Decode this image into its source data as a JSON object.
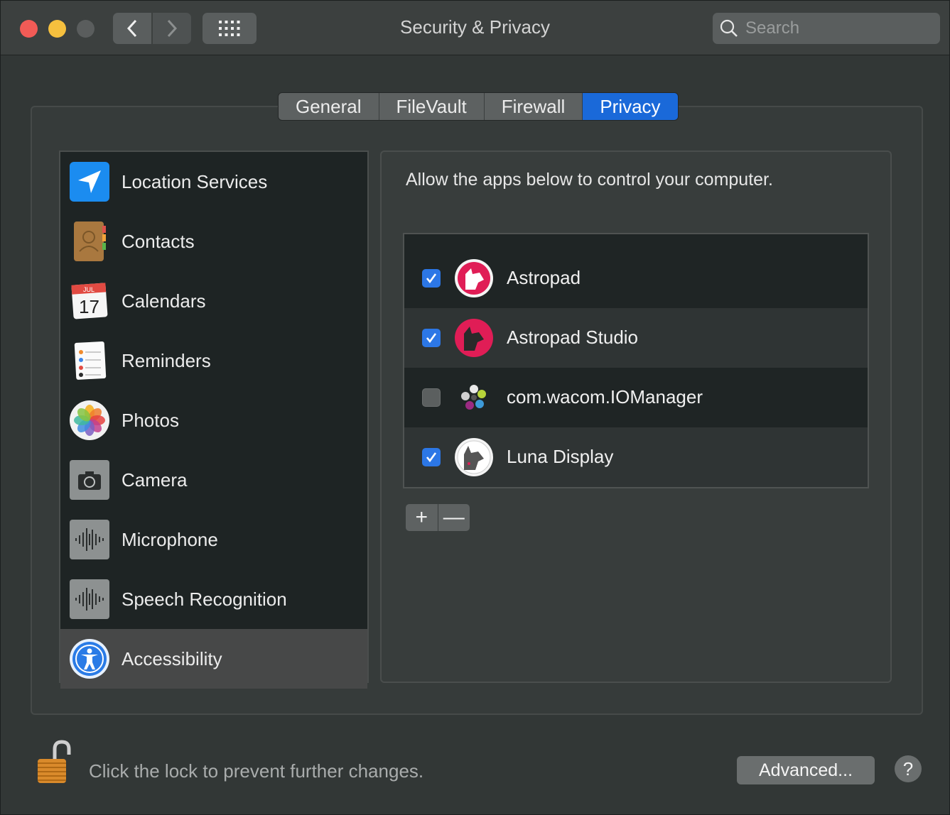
{
  "window": {
    "title": "Security & Privacy",
    "search_placeholder": "Search"
  },
  "tabs": [
    {
      "label": "General",
      "active": false
    },
    {
      "label": "FileVault",
      "active": false
    },
    {
      "label": "Firewall",
      "active": false
    },
    {
      "label": "Privacy",
      "active": true
    }
  ],
  "sidebar": {
    "items": [
      {
        "label": "Location Services",
        "icon": "location-arrow-icon"
      },
      {
        "label": "Contacts",
        "icon": "contacts-book-icon"
      },
      {
        "label": "Calendars",
        "icon": "calendar-icon",
        "month": "JUL",
        "day": "17"
      },
      {
        "label": "Reminders",
        "icon": "reminders-list-icon"
      },
      {
        "label": "Photos",
        "icon": "photos-flower-icon"
      },
      {
        "label": "Camera",
        "icon": "camera-icon"
      },
      {
        "label": "Microphone",
        "icon": "microphone-waveform-icon"
      },
      {
        "label": "Speech Recognition",
        "icon": "speech-waveform-icon"
      },
      {
        "label": "Accessibility",
        "icon": "accessibility-icon",
        "selected": true
      }
    ]
  },
  "content": {
    "description": "Allow the apps below to control your computer.",
    "apps": [
      {
        "label": "Astropad",
        "checked": true,
        "icon": "astropad-icon"
      },
      {
        "label": "Astropad Studio",
        "checked": true,
        "icon": "astropad-studio-icon"
      },
      {
        "label": "com.wacom.IOManager",
        "checked": false,
        "icon": "wacom-icon"
      },
      {
        "label": "Luna Display",
        "checked": true,
        "icon": "luna-display-icon"
      }
    ],
    "add_label": "+",
    "remove_label": "—"
  },
  "footer": {
    "lock_text": "Click the lock to prevent further changes.",
    "advanced_label": "Advanced...",
    "help_label": "?"
  },
  "colors": {
    "accent": "#1a69d9",
    "checkbox_on": "#2c77e6",
    "close": "#f25b56",
    "minimize": "#f6c03e"
  }
}
